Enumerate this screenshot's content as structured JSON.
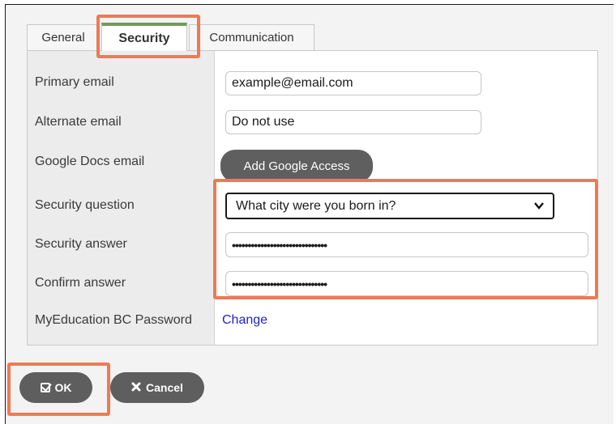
{
  "tabs": [
    {
      "label": "General"
    },
    {
      "label": "Security"
    },
    {
      "label": "Communication"
    }
  ],
  "fields": {
    "primary_email": {
      "label": "Primary email",
      "value": "example@email.com"
    },
    "alternate_email": {
      "label": "Alternate email",
      "value": "Do not use"
    },
    "google_docs_email": {
      "label": "Google Docs email",
      "button": "Add Google Access"
    },
    "security_question": {
      "label": "Security question",
      "value": "What city were you born in?"
    },
    "security_answer": {
      "label": "Security answer",
      "value": "••••••••••••••••••••••••••••••"
    },
    "confirm_answer": {
      "label": "Confirm answer",
      "value": "••••••••••••••••••••••••••••••"
    },
    "myeducation_password": {
      "label": "MyEducation BC Password",
      "link": "Change"
    }
  },
  "footer": {
    "ok_label": "OK",
    "cancel_label": "Cancel"
  },
  "colors": {
    "highlight": "#ee7a55",
    "active_tab_accent": "#6f9b5a",
    "button_bg": "#5e5e5e",
    "link": "#1f22c7"
  }
}
